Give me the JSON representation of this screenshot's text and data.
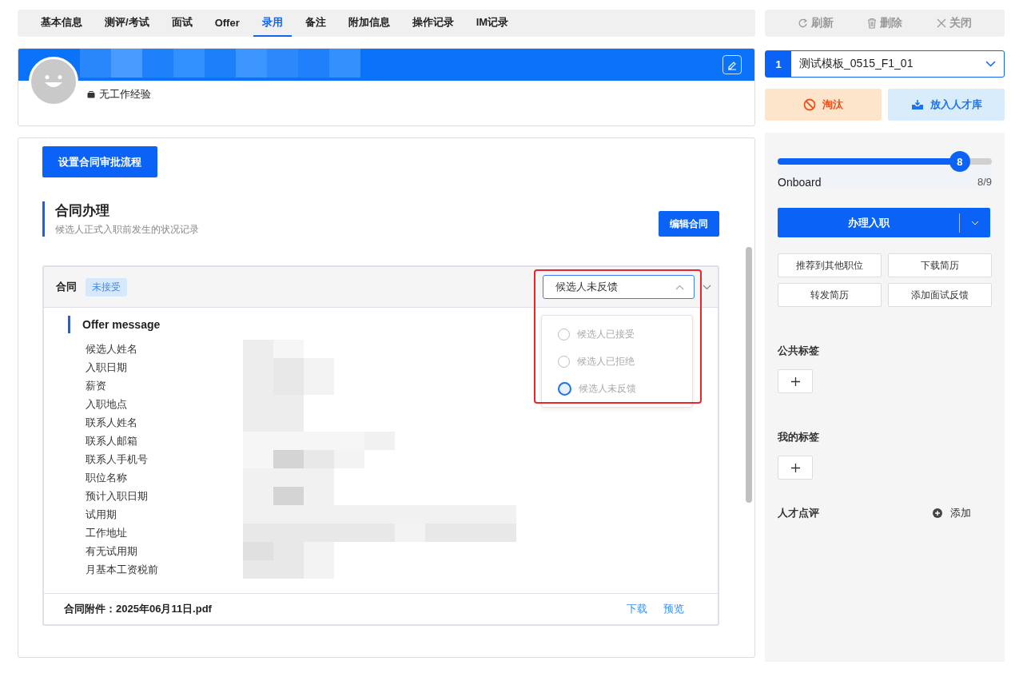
{
  "tabs": [
    {
      "label": "基本信息",
      "selected": false
    },
    {
      "label": "测评/考试",
      "selected": false
    },
    {
      "label": "面试",
      "selected": false
    },
    {
      "label": "Offer",
      "selected": false
    },
    {
      "label": "录用",
      "selected": true
    },
    {
      "label": "备注",
      "selected": false
    },
    {
      "label": "附加信息",
      "selected": false
    },
    {
      "label": "操作记录",
      "selected": false
    },
    {
      "label": "IM记录",
      "selected": false
    }
  ],
  "profile": {
    "experience": "无工作经验"
  },
  "approval_button": "设置合同审批流程",
  "section": {
    "title": "合同办理",
    "subtitle": "候选人正式入职前发生的状况记录",
    "edit_button": "编辑合同"
  },
  "contract": {
    "title": "合同",
    "status": "未接受",
    "expanded": true,
    "status_select": {
      "value": "候选人未反馈",
      "open": true,
      "options": [
        {
          "label": "候选人已接受",
          "selected": false
        },
        {
          "label": "候选人已拒绝",
          "selected": false
        },
        {
          "label": "候选人未反馈",
          "selected": true
        }
      ]
    },
    "offer_title": "Offer message",
    "fields": [
      {
        "label": "候选人姓名"
      },
      {
        "label": "入职日期"
      },
      {
        "label": "薪资"
      },
      {
        "label": "入职地点"
      },
      {
        "label": "联系人姓名"
      },
      {
        "label": "联系人邮箱"
      },
      {
        "label": "联系人手机号"
      },
      {
        "label": "职位名称"
      },
      {
        "label": "预计入职日期"
      },
      {
        "label": "试用期"
      },
      {
        "label": "工作地址"
      },
      {
        "label": "有无试用期"
      },
      {
        "label": "月基本工资税前"
      }
    ],
    "attachment": "合同附件：2025年06月11日.pdf",
    "links": [
      "下载",
      "预览"
    ]
  },
  "toolbar": [
    {
      "kind": "refresh",
      "label": "刷新"
    },
    {
      "kind": "delete",
      "label": "删除"
    },
    {
      "kind": "close",
      "label": "关闭"
    }
  ],
  "template_select": {
    "index": "1",
    "value": "测试模板_0515_F1_01"
  },
  "actions": [
    {
      "kind": "reject",
      "label": "淘汰"
    },
    {
      "kind": "pool",
      "label": "放入人才库"
    }
  ],
  "progress": {
    "level": 0.85,
    "step": "8",
    "stage": "Onboard",
    "count": "8/9"
  },
  "primary_button": "办理入职",
  "secondary_buttons": [
    "推荐到其他职位",
    "下载简历",
    "转发简历",
    "添加面试反馈"
  ],
  "tag_groups": [
    {
      "title": "公共标签"
    },
    {
      "title": "我的标签"
    }
  ],
  "review": {
    "title": "人才点评",
    "add": "添加"
  }
}
